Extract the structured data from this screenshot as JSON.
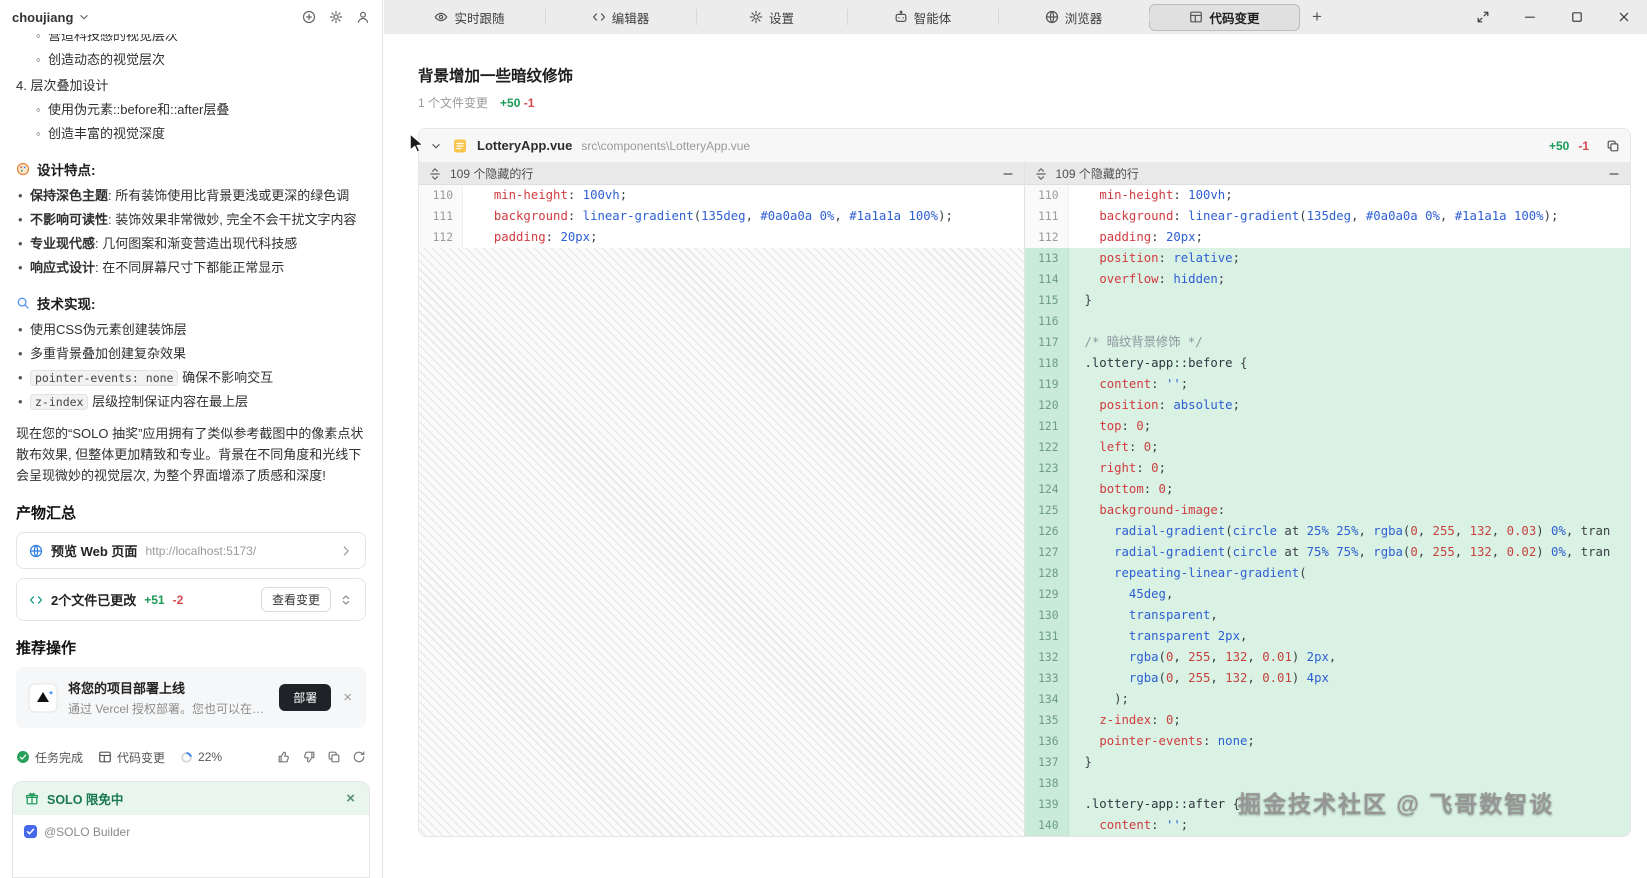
{
  "sidebar": {
    "workspace_name": "choujiang",
    "chat": {
      "clipped_item": "营造科技感的视觉层次",
      "second_item": "创造动态的视觉层次",
      "numbered_item": "4. 层次叠加设计",
      "numbered_subitems": [
        "使用伪元素::before和::after层叠",
        "创造丰富的视觉深度"
      ],
      "design_section": {
        "icon": "palette-icon",
        "title": "设计特点:",
        "items": [
          {
            "bold": "保持深色主题",
            "text": ": 所有装饰使用比背景更浅或更深的绿色调"
          },
          {
            "bold": "不影响可读性",
            "text": ": 装饰效果非常微妙, 完全不会干扰文字内容"
          },
          {
            "bold": "专业现代感",
            "text": ": 几何图案和渐变营造出现代科技感"
          },
          {
            "bold": "响应式设计",
            "text": ": 在不同屏幕尺寸下都能正常显示"
          }
        ]
      },
      "tech_section": {
        "icon": "magnifier-icon",
        "title": "技术实现:",
        "items": [
          {
            "text": "使用CSS伪元素创建装饰层"
          },
          {
            "text": "多重背景叠加创建复杂效果"
          },
          {
            "code": "pointer-events: none",
            "text": " 确保不影响交互"
          },
          {
            "code": "z-index",
            "text": " 层级控制保证内容在最上层"
          }
        ]
      },
      "summary_paragraph": "现在您的“SOLO 抽奖”应用拥有了类似参考截图中的像素点状散布效果, 但整体更加精致和专业。背景在不同角度和光线下会呈现微妙的视觉层次, 为整个界面增添了质感和深度!"
    },
    "artifacts": {
      "heading": "产物汇总",
      "preview_card": {
        "title": "预览 Web 页面",
        "url": "http://localhost:5173/"
      },
      "changes_card": {
        "title": "2个文件已更改",
        "added": "+51",
        "removed": "-2",
        "button": "查看变更"
      }
    },
    "recommend": {
      "heading": "推荐操作",
      "deploy_card": {
        "title": "将您的项目部署上线",
        "subtitle": "通过 Vercel 授权部署。您也可以在对话中...",
        "button": "部署"
      }
    },
    "status_bar": {
      "task_done": "任务完成",
      "code_change": "代码变更",
      "progress": "22%",
      "progress_value": 22
    },
    "promo_banner": {
      "text": "SOLO 限免中"
    },
    "composer": {
      "chip": "@SOLO Builder"
    }
  },
  "titlebar": {
    "new_tab_label": "+",
    "tabs": [
      {
        "label": "实时跟随",
        "icon": "eye"
      },
      {
        "label": "编辑器",
        "icon": "code"
      },
      {
        "label": "设置",
        "icon": "gear"
      },
      {
        "label": "智能体",
        "icon": "agent"
      },
      {
        "label": "浏览器",
        "icon": "globe"
      },
      {
        "label": "代码变更",
        "icon": "table",
        "active": true
      }
    ]
  },
  "main": {
    "title": "背景增加一些暗纹修饰",
    "change_summary": {
      "files": "1 个文件变更",
      "added": "+50",
      "removed": "-1"
    },
    "file_card": {
      "filename": "LotteryApp.vue",
      "filepath": "src\\components\\LotteryApp.vue",
      "added": "+50",
      "removed": "-1"
    }
  },
  "diff": {
    "hidden_label": "109 个隐藏的行",
    "left_lines": [
      {
        "n": 110,
        "t": "ctx",
        "seg": [
          [
            "pln",
            "  "
          ],
          [
            "p",
            "min-height"
          ],
          [
            "pln",
            ": "
          ],
          [
            "v",
            "100vh"
          ],
          [
            "pln",
            ";"
          ]
        ]
      },
      {
        "n": 111,
        "t": "ctx",
        "seg": [
          [
            "pln",
            "  "
          ],
          [
            "p",
            "background"
          ],
          [
            "pln",
            ": "
          ],
          [
            "f",
            "linear-gradient"
          ],
          [
            "pln",
            "("
          ],
          [
            "v",
            "135deg"
          ],
          [
            "pln",
            ", "
          ],
          [
            "v",
            "#0a0a0a"
          ],
          [
            "pln",
            " "
          ],
          [
            "v",
            "0%"
          ],
          [
            "pln",
            ", "
          ],
          [
            "v",
            "#1a1a1a"
          ],
          [
            "pln",
            " "
          ],
          [
            "v",
            "100%"
          ],
          [
            "pln",
            ");"
          ]
        ]
      },
      {
        "n": 112,
        "t": "ctx",
        "seg": [
          [
            "pln",
            "  "
          ],
          [
            "p",
            "padding"
          ],
          [
            "pln",
            ": "
          ],
          [
            "v",
            "20px"
          ],
          [
            "pln",
            ";"
          ]
        ]
      }
    ],
    "right_lines": [
      {
        "n": 110,
        "t": "ctx",
        "seg": [
          [
            "pln",
            "  "
          ],
          [
            "p",
            "min-height"
          ],
          [
            "pln",
            ": "
          ],
          [
            "v",
            "100vh"
          ],
          [
            "pln",
            ";"
          ]
        ]
      },
      {
        "n": 111,
        "t": "ctx",
        "seg": [
          [
            "pln",
            "  "
          ],
          [
            "p",
            "background"
          ],
          [
            "pln",
            ": "
          ],
          [
            "f",
            "linear-gradient"
          ],
          [
            "pln",
            "("
          ],
          [
            "v",
            "135deg"
          ],
          [
            "pln",
            ", "
          ],
          [
            "v",
            "#0a0a0a"
          ],
          [
            "pln",
            " "
          ],
          [
            "v",
            "0%"
          ],
          [
            "pln",
            ", "
          ],
          [
            "v",
            "#1a1a1a"
          ],
          [
            "pln",
            " "
          ],
          [
            "v",
            "100%"
          ],
          [
            "pln",
            ");"
          ]
        ]
      },
      {
        "n": 112,
        "t": "ctx",
        "seg": [
          [
            "pln",
            "  "
          ],
          [
            "p",
            "padding"
          ],
          [
            "pln",
            ": "
          ],
          [
            "v",
            "20px"
          ],
          [
            "pln",
            ";"
          ]
        ]
      },
      {
        "n": 113,
        "t": "add",
        "seg": [
          [
            "pln",
            "  "
          ],
          [
            "p",
            "position"
          ],
          [
            "pln",
            ": "
          ],
          [
            "v",
            "relative"
          ],
          [
            "pln",
            ";"
          ]
        ]
      },
      {
        "n": 114,
        "t": "add",
        "seg": [
          [
            "pln",
            "  "
          ],
          [
            "p",
            "overflow"
          ],
          [
            "pln",
            ": "
          ],
          [
            "v",
            "hidden"
          ],
          [
            "pln",
            ";"
          ]
        ]
      },
      {
        "n": 115,
        "t": "add",
        "seg": [
          [
            "pln",
            "}"
          ]
        ]
      },
      {
        "n": 116,
        "t": "add",
        "seg": []
      },
      {
        "n": 117,
        "t": "add",
        "seg": [
          [
            "c",
            "/* 暗纹背景修饰 */"
          ]
        ]
      },
      {
        "n": 118,
        "t": "add",
        "seg": [
          [
            "sel",
            ".lottery-app::before"
          ],
          [
            "pln",
            " {"
          ]
        ]
      },
      {
        "n": 119,
        "t": "add",
        "seg": [
          [
            "pln",
            "  "
          ],
          [
            "p",
            "content"
          ],
          [
            "pln",
            ": "
          ],
          [
            "s",
            "''"
          ],
          [
            "pln",
            ";"
          ]
        ]
      },
      {
        "n": 120,
        "t": "add",
        "seg": [
          [
            "pln",
            "  "
          ],
          [
            "p",
            "position"
          ],
          [
            "pln",
            ": "
          ],
          [
            "v",
            "absolute"
          ],
          [
            "pln",
            ";"
          ]
        ]
      },
      {
        "n": 121,
        "t": "add",
        "seg": [
          [
            "pln",
            "  "
          ],
          [
            "p",
            "top"
          ],
          [
            "pln",
            ": "
          ],
          [
            "n",
            "0"
          ],
          [
            "pln",
            ";"
          ]
        ]
      },
      {
        "n": 122,
        "t": "add",
        "seg": [
          [
            "pln",
            "  "
          ],
          [
            "p",
            "left"
          ],
          [
            "pln",
            ": "
          ],
          [
            "n",
            "0"
          ],
          [
            "pln",
            ";"
          ]
        ]
      },
      {
        "n": 123,
        "t": "add",
        "seg": [
          [
            "pln",
            "  "
          ],
          [
            "p",
            "right"
          ],
          [
            "pln",
            ": "
          ],
          [
            "n",
            "0"
          ],
          [
            "pln",
            ";"
          ]
        ]
      },
      {
        "n": 124,
        "t": "add",
        "seg": [
          [
            "pln",
            "  "
          ],
          [
            "p",
            "bottom"
          ],
          [
            "pln",
            ": "
          ],
          [
            "n",
            "0"
          ],
          [
            "pln",
            ";"
          ]
        ]
      },
      {
        "n": 125,
        "t": "add",
        "seg": [
          [
            "pln",
            "  "
          ],
          [
            "p",
            "background-image"
          ],
          [
            "pln",
            ":"
          ]
        ]
      },
      {
        "n": 126,
        "t": "add",
        "seg": [
          [
            "pln",
            "    "
          ],
          [
            "f",
            "radial-gradient"
          ],
          [
            "pln",
            "("
          ],
          [
            "v",
            "circle"
          ],
          [
            "pln",
            " at "
          ],
          [
            "v",
            "25%"
          ],
          [
            "pln",
            " "
          ],
          [
            "v",
            "25%"
          ],
          [
            "pln",
            ", "
          ],
          [
            "f",
            "rgba"
          ],
          [
            "pln",
            "("
          ],
          [
            "n",
            "0"
          ],
          [
            "pln",
            ", "
          ],
          [
            "n",
            "255"
          ],
          [
            "pln",
            ", "
          ],
          [
            "n",
            "132"
          ],
          [
            "pln",
            ", "
          ],
          [
            "n",
            "0.03"
          ],
          [
            "pln",
            ") "
          ],
          [
            "v",
            "0%"
          ],
          [
            "pln",
            ", tran"
          ]
        ]
      },
      {
        "n": 127,
        "t": "add",
        "seg": [
          [
            "pln",
            "    "
          ],
          [
            "f",
            "radial-gradient"
          ],
          [
            "pln",
            "("
          ],
          [
            "v",
            "circle"
          ],
          [
            "pln",
            " at "
          ],
          [
            "v",
            "75%"
          ],
          [
            "pln",
            " "
          ],
          [
            "v",
            "75%"
          ],
          [
            "pln",
            ", "
          ],
          [
            "f",
            "rgba"
          ],
          [
            "pln",
            "("
          ],
          [
            "n",
            "0"
          ],
          [
            "pln",
            ", "
          ],
          [
            "n",
            "255"
          ],
          [
            "pln",
            ", "
          ],
          [
            "n",
            "132"
          ],
          [
            "pln",
            ", "
          ],
          [
            "n",
            "0.02"
          ],
          [
            "pln",
            ") "
          ],
          [
            "v",
            "0%"
          ],
          [
            "pln",
            ", tran"
          ]
        ]
      },
      {
        "n": 128,
        "t": "add",
        "seg": [
          [
            "pln",
            "    "
          ],
          [
            "f",
            "repeating-linear-gradient"
          ],
          [
            "pln",
            "("
          ]
        ]
      },
      {
        "n": 129,
        "t": "add",
        "seg": [
          [
            "pln",
            "      "
          ],
          [
            "v",
            "45deg"
          ],
          [
            "pln",
            ","
          ]
        ]
      },
      {
        "n": 130,
        "t": "add",
        "seg": [
          [
            "pln",
            "      "
          ],
          [
            "v",
            "transparent"
          ],
          [
            "pln",
            ","
          ]
        ]
      },
      {
        "n": 131,
        "t": "add",
        "seg": [
          [
            "pln",
            "      "
          ],
          [
            "v",
            "transparent"
          ],
          [
            "pln",
            " "
          ],
          [
            "v",
            "2px"
          ],
          [
            "pln",
            ","
          ]
        ]
      },
      {
        "n": 132,
        "t": "add",
        "seg": [
          [
            "pln",
            "      "
          ],
          [
            "f",
            "rgba"
          ],
          [
            "pln",
            "("
          ],
          [
            "n",
            "0"
          ],
          [
            "pln",
            ", "
          ],
          [
            "n",
            "255"
          ],
          [
            "pln",
            ", "
          ],
          [
            "n",
            "132"
          ],
          [
            "pln",
            ", "
          ],
          [
            "n",
            "0.01"
          ],
          [
            "pln",
            ") "
          ],
          [
            "v",
            "2px"
          ],
          [
            "pln",
            ","
          ]
        ]
      },
      {
        "n": 133,
        "t": "add",
        "seg": [
          [
            "pln",
            "      "
          ],
          [
            "f",
            "rgba"
          ],
          [
            "pln",
            "("
          ],
          [
            "n",
            "0"
          ],
          [
            "pln",
            ", "
          ],
          [
            "n",
            "255"
          ],
          [
            "pln",
            ", "
          ],
          [
            "n",
            "132"
          ],
          [
            "pln",
            ", "
          ],
          [
            "n",
            "0.01"
          ],
          [
            "pln",
            ") "
          ],
          [
            "v",
            "4px"
          ]
        ]
      },
      {
        "n": 134,
        "t": "add",
        "seg": [
          [
            "pln",
            "    );"
          ]
        ]
      },
      {
        "n": 135,
        "t": "add",
        "seg": [
          [
            "pln",
            "  "
          ],
          [
            "p",
            "z-index"
          ],
          [
            "pln",
            ": "
          ],
          [
            "n",
            "0"
          ],
          [
            "pln",
            ";"
          ]
        ]
      },
      {
        "n": 136,
        "t": "add",
        "seg": [
          [
            "pln",
            "  "
          ],
          [
            "p",
            "pointer-events"
          ],
          [
            "pln",
            ": "
          ],
          [
            "v",
            "none"
          ],
          [
            "pln",
            ";"
          ]
        ]
      },
      {
        "n": 137,
        "t": "add",
        "seg": [
          [
            "pln",
            "}"
          ]
        ]
      },
      {
        "n": 138,
        "t": "add",
        "seg": []
      },
      {
        "n": 139,
        "t": "add",
        "seg": [
          [
            "sel",
            ".lottery-app::after"
          ],
          [
            "pln",
            " {"
          ]
        ]
      },
      {
        "n": 140,
        "t": "add",
        "seg": [
          [
            "pln",
            "  "
          ],
          [
            "p",
            "content"
          ],
          [
            "pln",
            ": "
          ],
          [
            "s",
            "''"
          ],
          [
            "pln",
            ";"
          ]
        ]
      }
    ]
  },
  "watermark": "掘金技术社区 @ 飞哥数智谈",
  "colors": {
    "added_text": "#1a9a55",
    "removed_text": "#d2494d",
    "added_row_bg": "#d9f2e3",
    "promo_green": "#18794e",
    "accent_blue": "#3b82f6"
  }
}
